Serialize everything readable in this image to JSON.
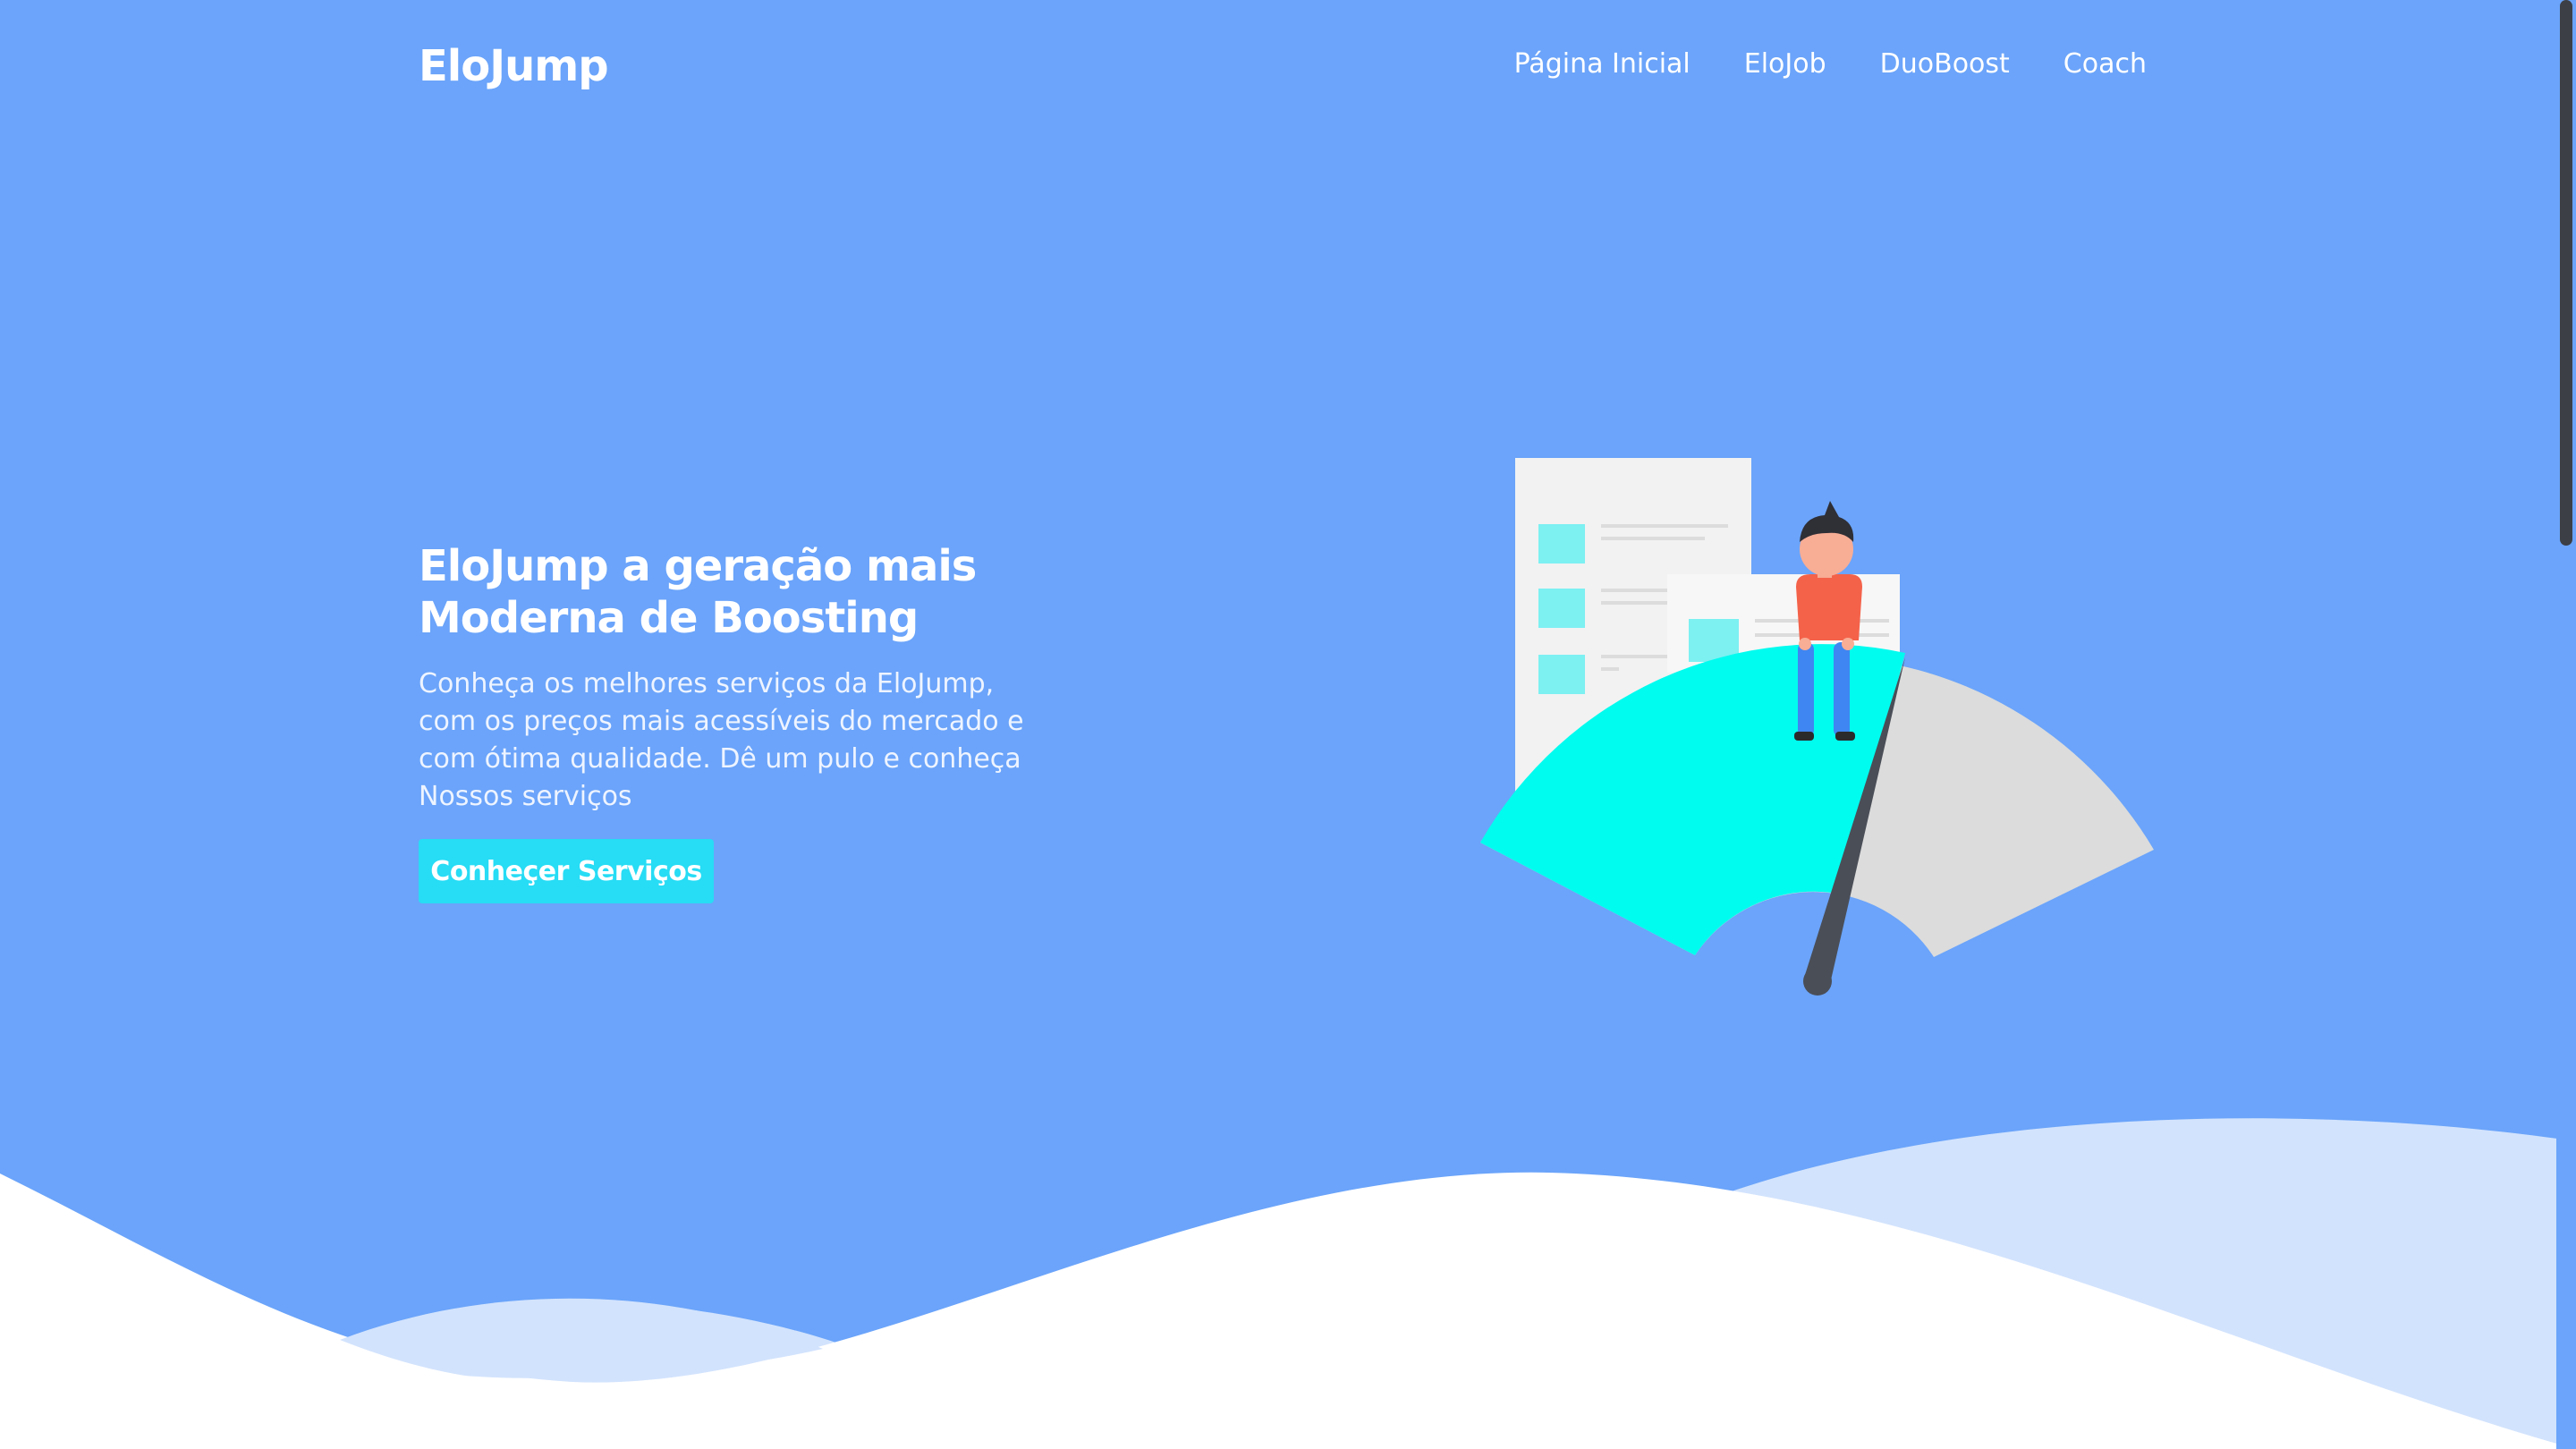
{
  "header": {
    "logo": "EloJump",
    "nav": [
      {
        "label": "Página Inicial"
      },
      {
        "label": "EloJob"
      },
      {
        "label": "DuoBoost"
      },
      {
        "label": "Coach"
      }
    ]
  },
  "hero": {
    "title_line1": "EloJump a geração mais",
    "title_line2": "Moderna de Boosting",
    "description": "Conheça os melhores serviços da EloJump, com os preços mais acessíveis do mercado e com ótima qualidade. Dê um pulo e conheça Nossos serviços",
    "cta_label": "Conheçer Serviços"
  },
  "colors": {
    "background": "#6ba4fa",
    "accent": "#27dcf5",
    "gauge_fill": "#00fcef",
    "gauge_track": "#dcdcdc",
    "needle": "#4a4e57",
    "wave_light": "#d2e3fd",
    "wave_white": "#ffffff"
  },
  "icons": {
    "illustration": "speed-gauge-person-illustration"
  }
}
